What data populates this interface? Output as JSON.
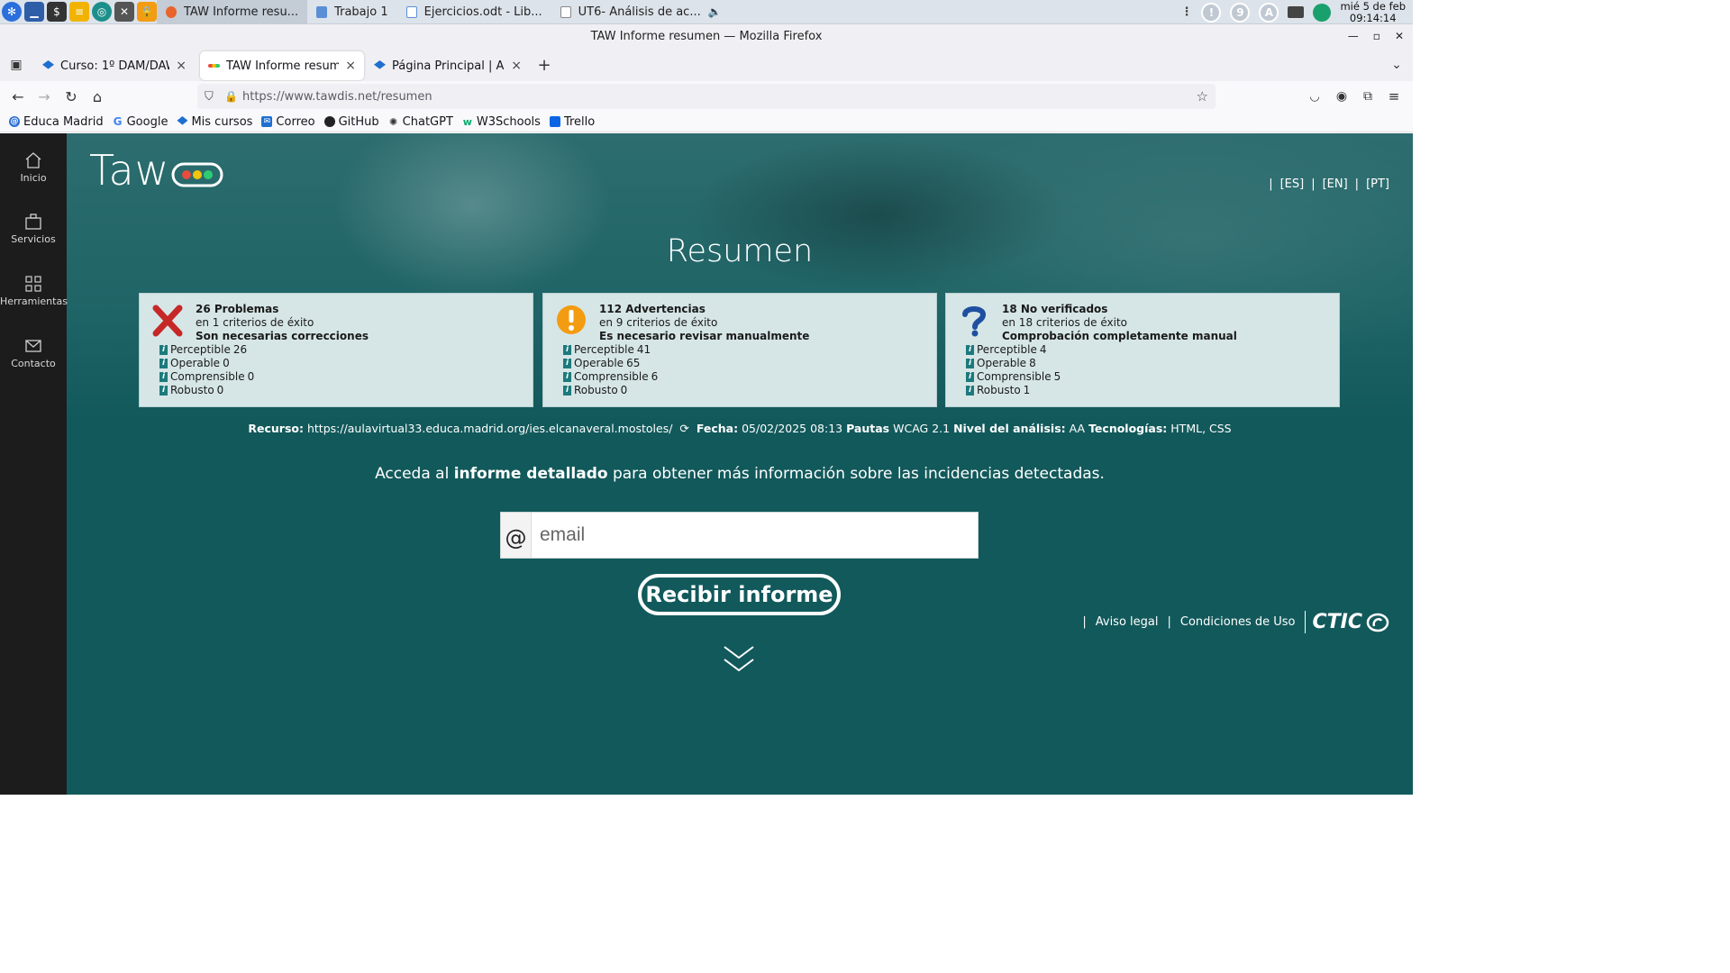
{
  "taskbar": {
    "tasks": [
      {
        "label": "TAW Informe resu...",
        "active": true
      },
      {
        "label": "Trabajo 1",
        "active": false
      },
      {
        "label": "Ejercicios.odt - Lib...",
        "active": false
      },
      {
        "label": "UT6- Análisis de ac...",
        "active": false
      }
    ],
    "tray_badges": [
      "!",
      "9",
      "A"
    ],
    "clock_date": "mié 5 de feb",
    "clock_time": "09:14:14"
  },
  "window": {
    "title": "TAW Informe resumen — Mozilla Firefox"
  },
  "tabs": [
    {
      "label": "Curso: 1º DAM/DAW Pro"
    },
    {
      "label": "TAW Informe resumen"
    },
    {
      "label": "Página Principal | AulaVir"
    }
  ],
  "navbar": {
    "url": "https://www.tawdis.net/resumen"
  },
  "bookmarks": [
    {
      "label": "Educa Madrid",
      "icon": "globe-icon"
    },
    {
      "label": "Google",
      "icon": "google-icon"
    },
    {
      "label": "Mis cursos",
      "icon": "cap-icon"
    },
    {
      "label": "Correo",
      "icon": "mail-icon"
    },
    {
      "label": "GitHub",
      "icon": "github-icon"
    },
    {
      "label": "ChatGPT",
      "icon": "chatgpt-icon"
    },
    {
      "label": "W3Schools",
      "icon": "w3-icon"
    },
    {
      "label": "Trello",
      "icon": "trello-icon"
    }
  ],
  "sidenav": [
    {
      "label": "Inicio",
      "icon": "home-icon"
    },
    {
      "label": "Servicios",
      "icon": "briefcase-icon"
    },
    {
      "label": "Herramientas",
      "icon": "grid-icon"
    },
    {
      "label": "Contacto",
      "icon": "envelope-icon"
    }
  ],
  "logo": {
    "word": "Taw"
  },
  "languages": [
    "[ES]",
    "[EN]",
    "[PT]"
  ],
  "page_title": "Resumen",
  "cards": [
    {
      "icon": "red-x-icon",
      "headline": "26 Problemas",
      "criteria": "en 1 criterios de éxito",
      "action": "Son necesarias correcciones",
      "principles": [
        {
          "label": "Perceptible",
          "value": "26"
        },
        {
          "label": "Operable",
          "value": "0"
        },
        {
          "label": "Comprensible",
          "value": "0"
        },
        {
          "label": "Robusto",
          "value": "0"
        }
      ]
    },
    {
      "icon": "warning-icon",
      "headline": "112 Advertencias",
      "criteria": "en 9 criterios de éxito",
      "action": "Es necesario revisar manualmente",
      "principles": [
        {
          "label": "Perceptible",
          "value": "41"
        },
        {
          "label": "Operable",
          "value": "65"
        },
        {
          "label": "Comprensible",
          "value": "6"
        },
        {
          "label": "Robusto",
          "value": "0"
        }
      ]
    },
    {
      "icon": "question-icon",
      "headline": "18 No verificados",
      "criteria": "en 18 criterios de éxito",
      "action": "Comprobación completamente manual",
      "principles": [
        {
          "label": "Perceptible",
          "value": "4"
        },
        {
          "label": "Operable",
          "value": "8"
        },
        {
          "label": "Comprensible",
          "value": "5"
        },
        {
          "label": "Robusto",
          "value": "1"
        }
      ]
    }
  ],
  "resource": {
    "resource_label": "Recurso:",
    "resource_url": "https://aulavirtual33.educa.madrid.org/ies.elcanaveral.mostoles/",
    "date_label": "Fecha:",
    "date_value": "05/02/2025 08:13",
    "guidelines_label": "Pautas",
    "guidelines_value": "WCAG 2.1",
    "level_label": "Nivel del análisis:",
    "level_value": "AA",
    "tech_label": "Tecnologías:",
    "tech_value": "HTML, CSS"
  },
  "cta": {
    "before": "Acceda al",
    "bold": "informe detallado",
    "after": "para obtener más información sobre las incidencias detectadas."
  },
  "email_form": {
    "at_symbol": "@",
    "placeholder": "email",
    "submit_label": "Recibir informe"
  },
  "footer": {
    "legal": "Aviso legal",
    "terms": "Condiciones de Uso",
    "brand": "CTIC"
  },
  "colors": {
    "page_bg": "#12595b",
    "sidenav_bg": "#1c1c1c",
    "card_bg": "#d6e6e7",
    "error_red": "#c62828",
    "warning_orange": "#f39c12",
    "question_blue": "#1f4fa0"
  }
}
